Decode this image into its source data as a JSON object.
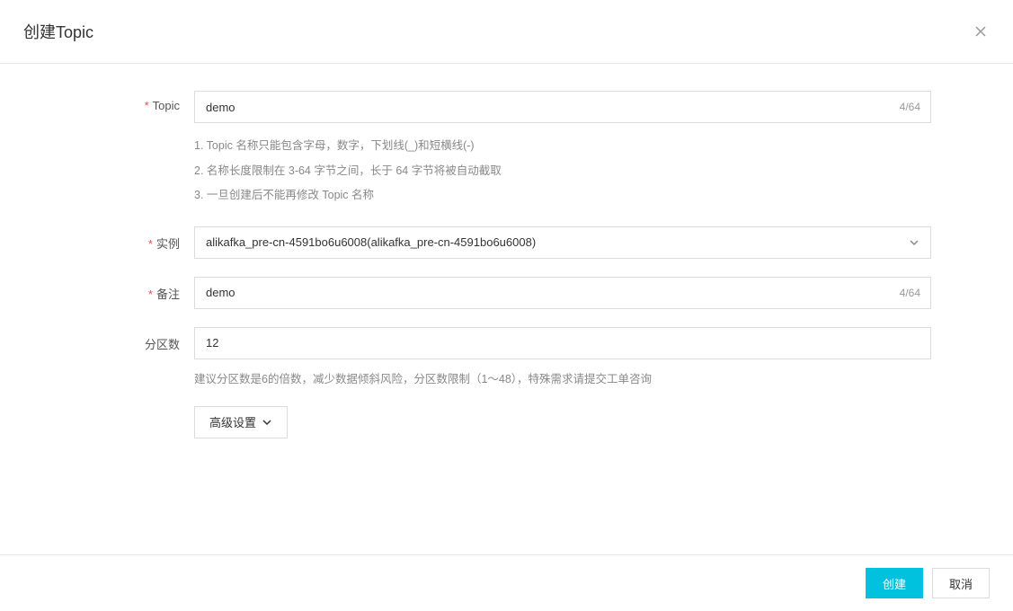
{
  "modal": {
    "title": "创建Topic"
  },
  "form": {
    "topic": {
      "label": "Topic",
      "value": "demo",
      "counter": "4/64",
      "help1": "1. Topic 名称只能包含字母，数字，下划线(_)和短横线(-)",
      "help2": "2. 名称长度限制在 3-64 字节之间，长于 64 字节将被自动截取",
      "help3": "3. 一旦创建后不能再修改 Topic 名称"
    },
    "instance": {
      "label": "实例",
      "value": "alikafka_pre-cn-4591bo6u6008(alikafka_pre-cn-4591bo6u6008)"
    },
    "remark": {
      "label": "备注",
      "value": "demo",
      "counter": "4/64"
    },
    "partitions": {
      "label": "分区数",
      "value": "12",
      "help": "建议分区数是6的倍数，减少数据倾斜风险，分区数限制（1～48），特殊需求请提交工单咨询"
    },
    "advanced": {
      "label": "高级设置"
    }
  },
  "footer": {
    "submit": "创建",
    "cancel": "取消"
  }
}
